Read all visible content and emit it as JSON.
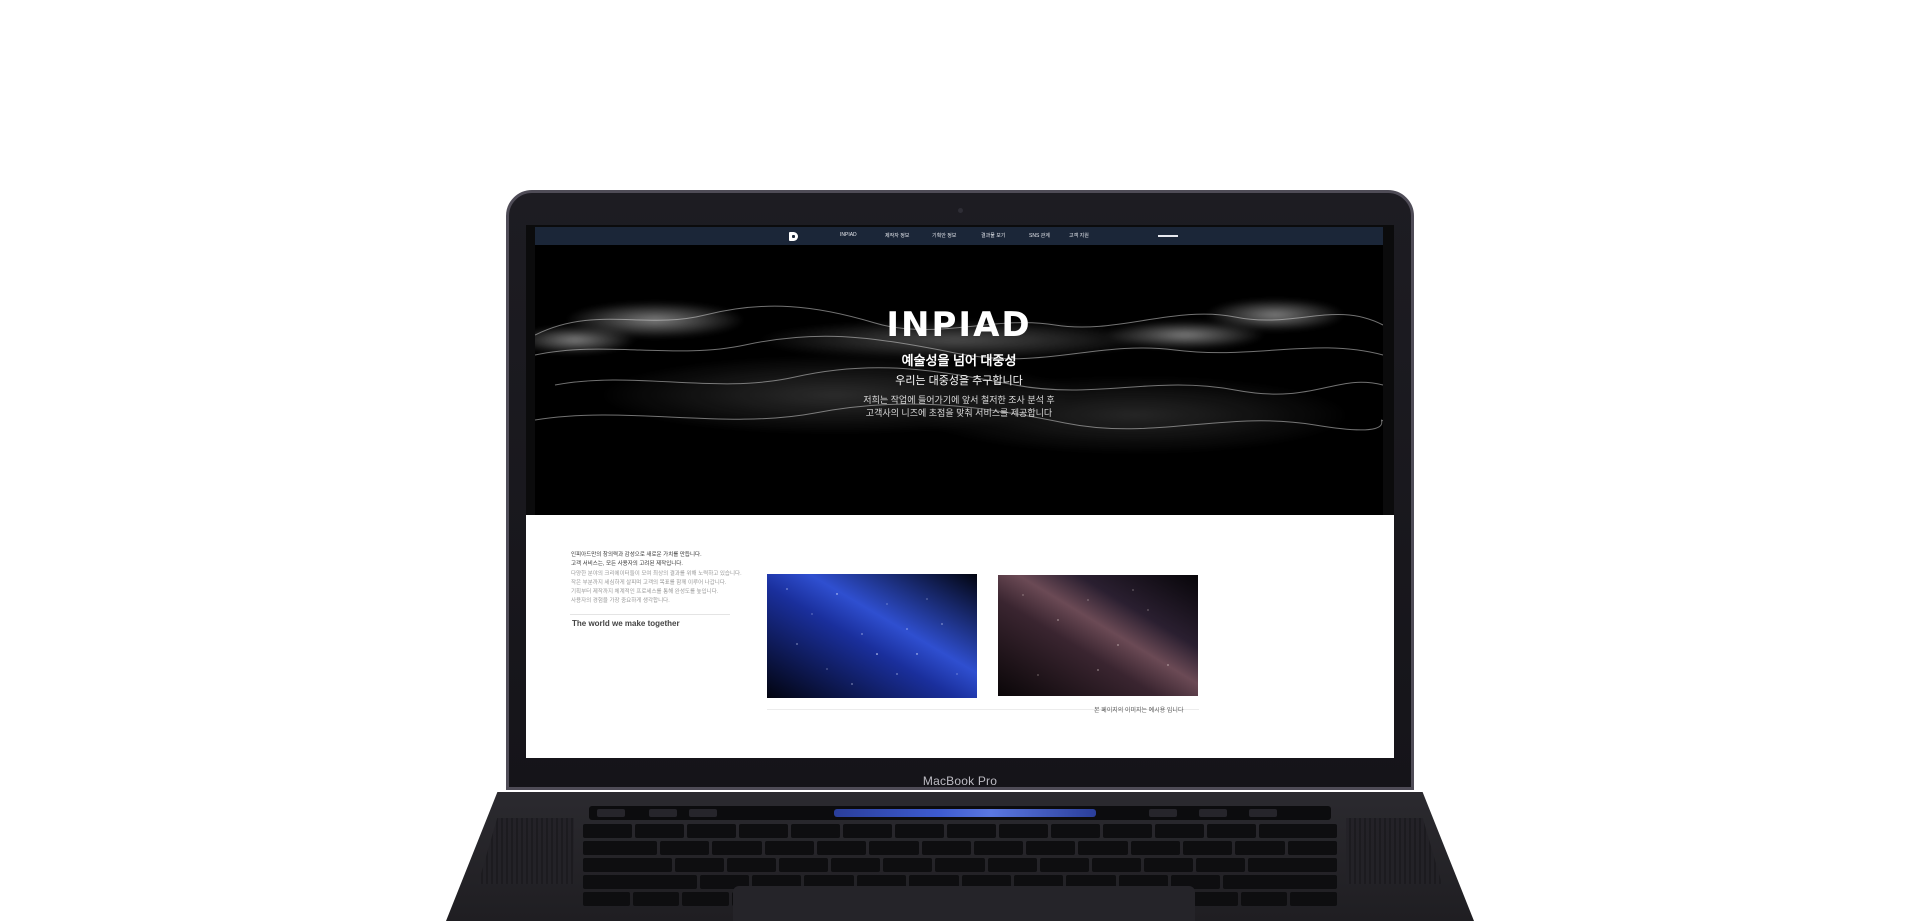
{
  "device": {
    "label": "MacBook Pro"
  },
  "nav": {
    "logo_icon": "inpiad-d-logo",
    "items": [
      "INPIAD",
      "제작자 정보",
      "기획안 정보",
      "결과물 보기",
      "SNS 관계",
      "고객 지원"
    ]
  },
  "hero": {
    "brand": "INPIAD",
    "headline": "예술성을 넘어 대중성",
    "subheadline": "우리는 대중성을 추구합니다",
    "body_line1": "저희는 작업에 들어가기에 앞서 철저한 조사 분석 후",
    "body_line2": "고객사의 니즈에 초점을 맞춰 서비스를 제공합니다"
  },
  "content": {
    "intro_line1": "인피아드만의 창의력과 감성으로 새로운 가치를 만듭니다.",
    "intro_line2": "고객 서비스는, 모든 사용자의 고려된 제작입니다.",
    "intro_line3": "다양한 분야의 크리에이터들이 모여 최상의 결과를 위해 노력하고 있습니다.",
    "intro_line4": "작은 부분까지 세심하게 살피며 고객의 목표를 함께 이루어 나갑니다.",
    "intro_line5": "기획부터 제작까지 체계적인 프로세스를 통해 완성도를 높입니다.",
    "intro_line6": "사용자의 경험을 가장 중요하게 생각합니다.",
    "tagline": "The world we make together",
    "caption": "본 페이지의 이미지는 예시용 입니다"
  }
}
